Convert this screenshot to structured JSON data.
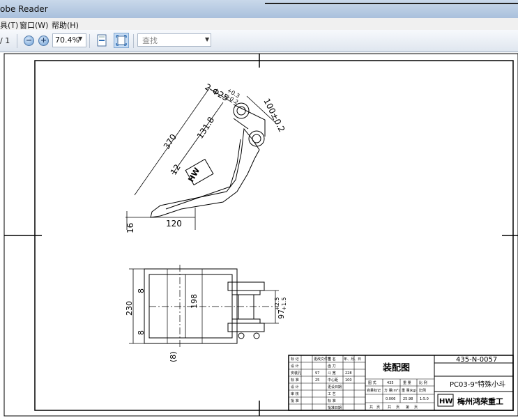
{
  "window": {
    "title": "obe Reader"
  },
  "menu": {
    "items": [
      "具(T)",
      "窗口(W)",
      "帮助(H)"
    ]
  },
  "toolbar": {
    "page_suffix": "/ 1",
    "zoom_out": "−",
    "zoom_in": "+",
    "zoom_value": "70.4%",
    "find_placeholder": "查找"
  },
  "drawing": {
    "dims": {
      "holes": "2-Φ25",
      "holes_tol_upper": "+0.3",
      "holes_tol_lower": "+0.2",
      "width_100": "100±0.2",
      "len_370": "370",
      "len_131": "131.8",
      "d12": "12",
      "d120": "120",
      "d16": "16",
      "h230": "230",
      "h198": "198",
      "d8a": "8",
      "d8b": "8",
      "d8paren": "(8)",
      "d97": "97",
      "d97_tol_upper": "+2.5",
      "d97_tol_lower": "+1.5"
    },
    "titleblock": {
      "assembly_title": "装配图",
      "drawing_no": "435-N-0057",
      "product_name": "PC03-9\"特殊小斗",
      "company": "梅州鸿荣重工",
      "logo": "HW",
      "left_labels": [
        "标记",
        "处数",
        "分区",
        "更改文件号",
        "签名",
        "年、月、日"
      ],
      "left_rows": [
        [
          "标 记",
          "",
          "更改文件号",
          "签 名",
          "年、月、日"
        ],
        [
          "设 计",
          "",
          "齿 刀",
          "",
          ""
        ],
        [
          "安装孔",
          "97",
          "斗 宽",
          "228",
          ""
        ],
        [
          "标 准",
          "25",
          "中心距",
          "100",
          ""
        ],
        [
          "设 计",
          "",
          "更设日期",
          "",
          ""
        ],
        [
          "审 核",
          "",
          "工 艺",
          "",
          ""
        ],
        [
          "批 准",
          "",
          "标 准",
          "",
          ""
        ],
        [
          "",
          "",
          "批准日期",
          "",
          ""
        ]
      ],
      "mid_header": [
        "图 式",
        "435",
        "重 量",
        "比 例"
      ],
      "mid_labels": [
        "容量标记",
        "方 量(m³)",
        "重 量(kg)",
        "比例"
      ],
      "mid_values": [
        "",
        "0.006",
        "25.98",
        "1:5.0"
      ],
      "sheet_row": [
        "共",
        "页",
        "共",
        "页",
        "第",
        "页"
      ]
    }
  }
}
